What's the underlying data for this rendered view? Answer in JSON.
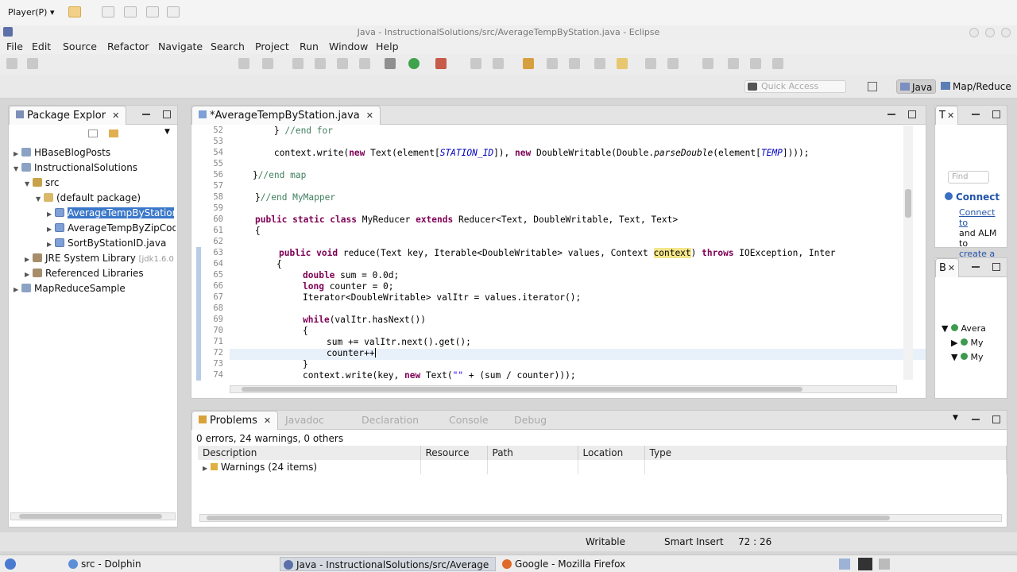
{
  "vm": {
    "player_label": "Player(P) ▾"
  },
  "window": {
    "title": "Java - InstructionalSolutions/src/AverageTempByStation.java - Eclipse"
  },
  "menu": [
    "File",
    "Edit",
    "Source",
    "Refactor",
    "Navigate",
    "Search",
    "Project",
    "Run",
    "Window",
    "Help"
  ],
  "quick_access": {
    "placeholder": "Quick Access"
  },
  "perspectives": [
    "Java",
    "Map/Reduce"
  ],
  "package_explorer": {
    "title": "Package Explor",
    "items": [
      {
        "label": "HBaseBlogPosts"
      },
      {
        "label": "InstructionalSolutions"
      },
      {
        "label": "src"
      },
      {
        "label": "(default package)"
      },
      {
        "label": "AverageTempByStation.java"
      },
      {
        "label": "AverageTempByZipCode"
      },
      {
        "label": "SortByStationID.java"
      },
      {
        "label": "JRE System Library",
        "suffix": "[jdk1.6.0"
      },
      {
        "label": "Referenced Libraries"
      },
      {
        "label": "MapReduceSample"
      }
    ]
  },
  "editor": {
    "tab_label": "*AverageTempByStation.java",
    "lines": [
      "52",
      "53",
      "54",
      "55",
      "56",
      "57",
      "58",
      "59",
      "60",
      "61",
      "62",
      "63",
      "64",
      "65",
      "66",
      "67",
      "68",
      "69",
      "70",
      "71",
      "72",
      "73",
      "74"
    ],
    "code": {
      "l52a": "        } ",
      "l52c": "//end for",
      "l54a": "        context.write(",
      "l54kw": "new",
      "l54b": " Text(element[",
      "l54c": "STATION_ID",
      "l54d": "]), ",
      "l54kw2": "new",
      "l54e": " DoubleWritable(Double.",
      "l54f": "parseDouble",
      "l54g": "(element[",
      "l54h": "TEMP",
      "l54i": "])));",
      "l56a": "    }",
      "l56c": "//end map",
      "l58a": "}",
      "l58c": "//end MyMapper",
      "l60kw": "public static class",
      "l60a": " MyReducer ",
      "l60kw2": "extends",
      "l60b": " Reducer<Text, DoubleWritable, Text, Text>",
      "l61": "{",
      "l63kw": "public void",
      "l63a": " reduce(Text key, Iterable<DoubleWritable> values, Context ",
      "l63occ": "context",
      "l63b": ") ",
      "l63kw2": "throws",
      "l63c": " IOException, Inter",
      "l64": "    {",
      "l65kw": "double",
      "l65a": " sum = 0.0d;",
      "l66kw": "long",
      "l66a": " counter = 0;",
      "l67a": "Iterator<DoubleWritable> valItr = values.iterator();",
      "l69kw": "while",
      "l69a": "(valItr.hasNext())",
      "l70": "{",
      "l71a": "sum += valItr.next().get();",
      "l72a": "counter++",
      "l73": "}",
      "l74a": "context.write(key, ",
      "l74kw": "new",
      "l74b": " Text(",
      "l74s": "\"\"",
      "l74c": " + (sum / counter)));"
    }
  },
  "task_panel": {
    "title": "T",
    "find_placeholder": "Find",
    "connect_title": "Connect",
    "connect_text1": "Connect to",
    "connect_text2": "and ALM to",
    "connect_link": "create a"
  },
  "outline_panel": {
    "title": "B",
    "items": [
      "Avera",
      "My",
      "My"
    ]
  },
  "problems": {
    "tabs": [
      "Problems",
      "Javadoc",
      "Declaration",
      "Console",
      "Debug"
    ],
    "summary": "0 errors, 24 warnings, 0 others",
    "columns": [
      "Description",
      "Resource",
      "Path",
      "Location",
      "Type"
    ],
    "rows": [
      {
        "description": "Warnings (24 items)"
      }
    ]
  },
  "status": {
    "writable": "Writable",
    "insert_mode": "Smart Insert",
    "position": "72 : 26"
  },
  "taskbar": [
    {
      "label": "src - Dolphin"
    },
    {
      "label": "Java - InstructionalSolutions/src/Average"
    },
    {
      "label": "Google - Mozilla Firefox"
    }
  ],
  "colors": {
    "keyword": "#7f0055",
    "comment": "#3f7f5f",
    "constant": "#0000c0",
    "selection": "#3b78c9"
  }
}
